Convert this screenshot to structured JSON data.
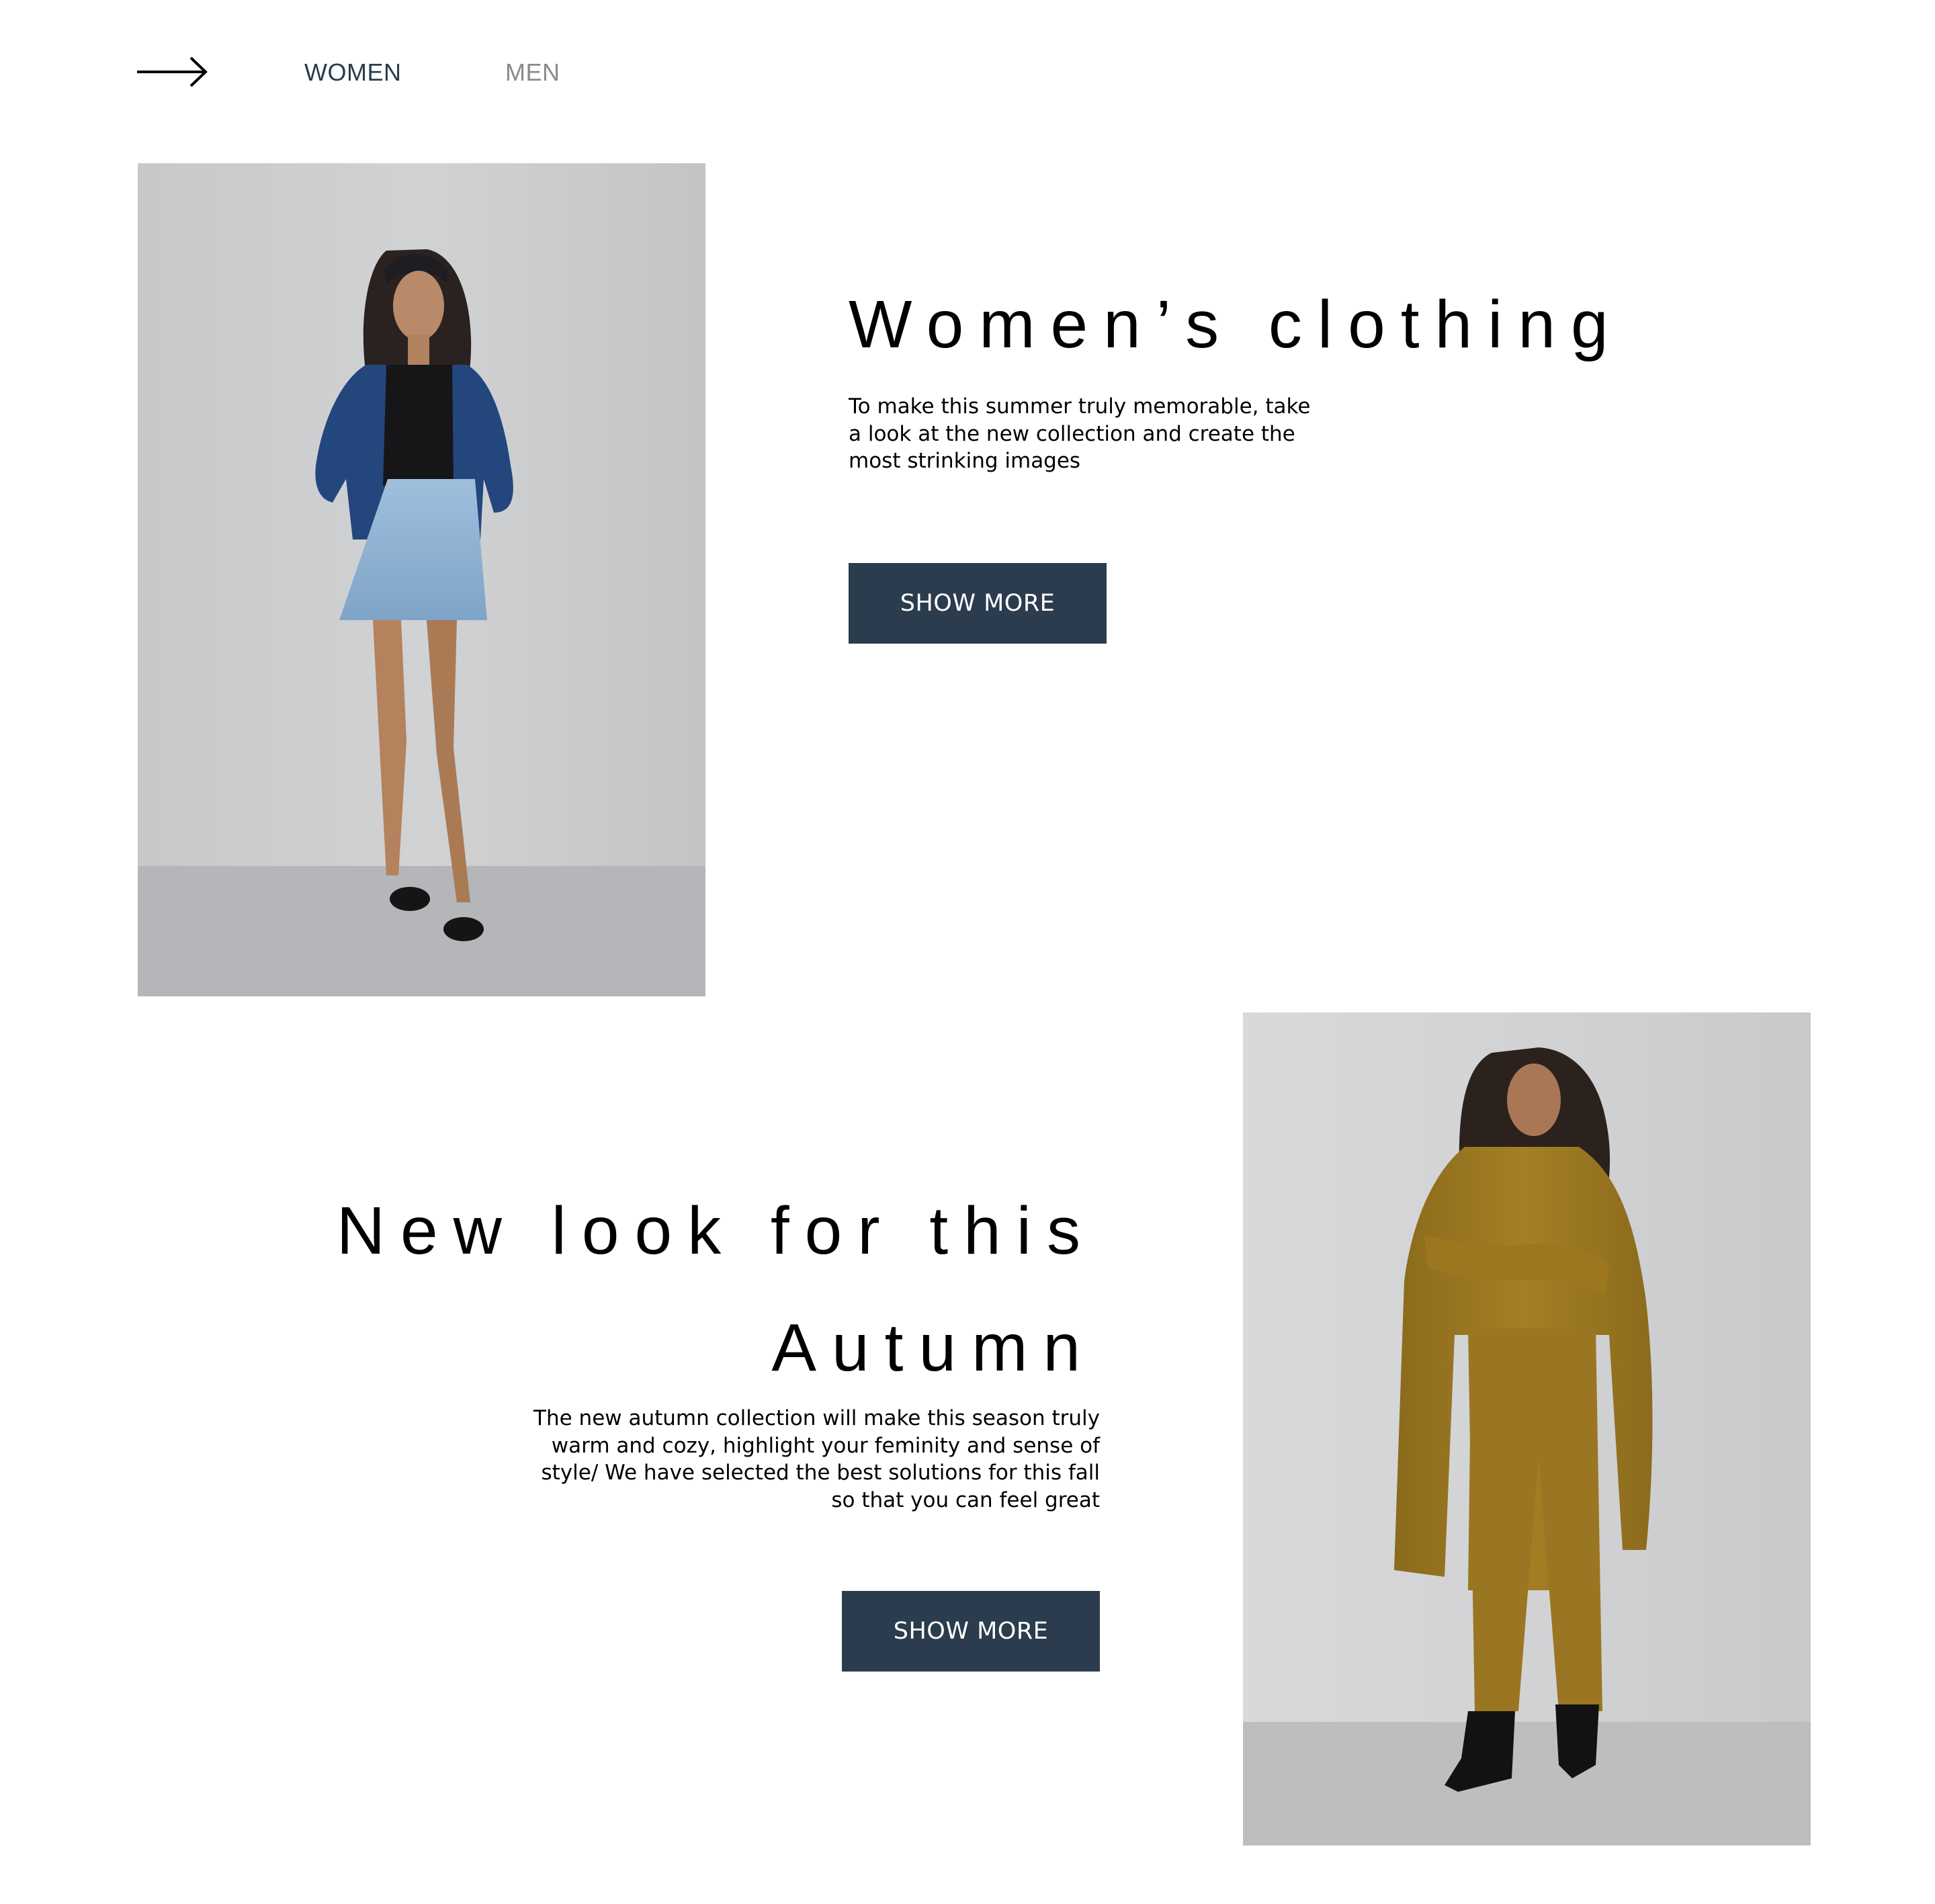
{
  "nav": {
    "back_icon": "arrow-right-icon",
    "items": [
      {
        "label": "WOMEN",
        "active": true
      },
      {
        "label": "MEN",
        "active": false
      }
    ],
    "active_color": "#2b3c4e",
    "inactive_color": "#8a8a8a"
  },
  "sections": [
    {
      "title": "Women’s clothing",
      "body": "To make this summer truly memorable, take a look at the new collection and create the most strinking images",
      "button_label": "SHOW MORE",
      "photo": "model-denim-outfit"
    },
    {
      "title_lines": [
        "New look for this",
        "Autumn"
      ],
      "body": "The new autumn collection will make this season truly warm and cozy, highlight your feminity and sense of style/ We have selected the best solutions for this fall so that you can feel great",
      "button_label": "SHOW MORE",
      "photo": "model-ochre-trench-outfit"
    }
  ],
  "colors": {
    "button_bg": "#2b3c4e",
    "button_text": "#ffffff",
    "heading": "#000000",
    "body": "#000000"
  }
}
